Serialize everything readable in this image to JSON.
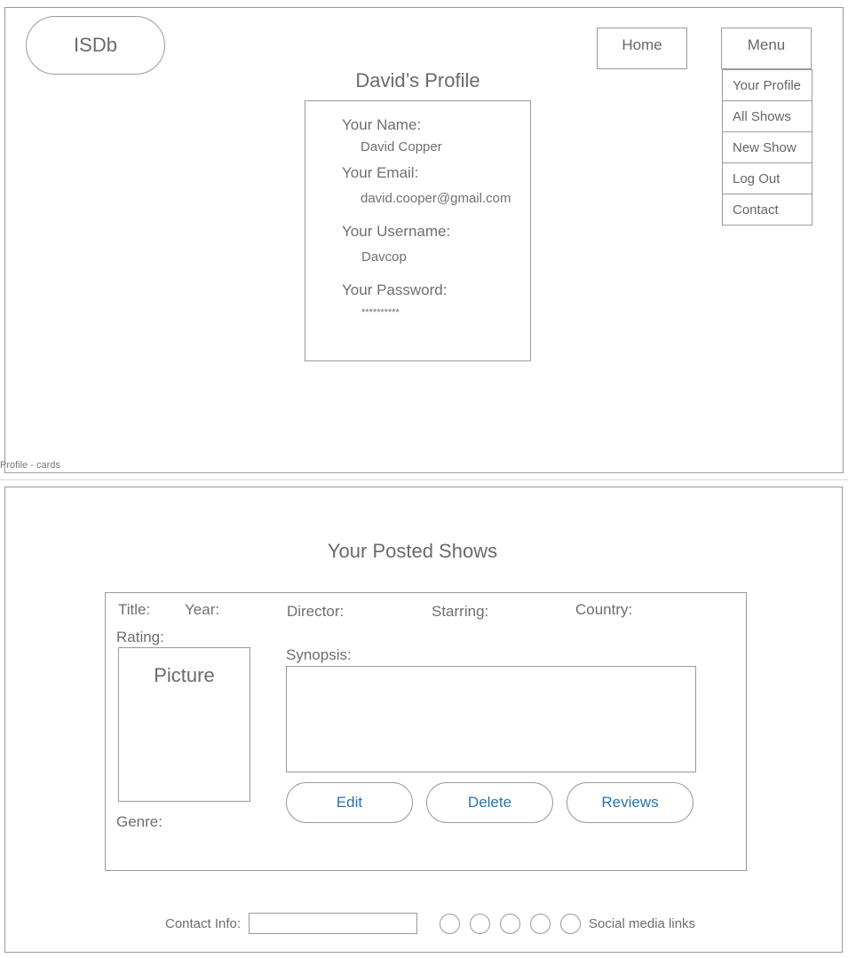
{
  "logo": {
    "text": "ISDb"
  },
  "nav": {
    "home_label": "Home",
    "menu_label": "Menu"
  },
  "menu": {
    "items": [
      {
        "label": "Your Profile"
      },
      {
        "label": "All Shows"
      },
      {
        "label": "New Show"
      },
      {
        "label": "Log Out"
      },
      {
        "label": "Contact"
      }
    ]
  },
  "profile": {
    "title": "David’s Profile",
    "name_label": "Your Name:",
    "name_value": "David Copper",
    "email_label": "Your Email:",
    "email_value": "david.cooper@gmail.com",
    "username_label": "Your Username:",
    "username_value": "Davcop",
    "password_label": "Your Password:",
    "password_value": "**********"
  },
  "frame_caption": "Profile - cards",
  "shows": {
    "title": "Your Posted Shows",
    "card": {
      "title_label": "Title:",
      "year_label": "Year:",
      "director_label": "Director:",
      "starring_label": "Starring:",
      "country_label": "Country:",
      "rating_label": "Rating:",
      "picture_label": "Picture",
      "synopsis_label": "Synopsis:",
      "genre_label": "Genre:",
      "edit_label": "Edit",
      "delete_label": "Delete",
      "reviews_label": "Reviews"
    }
  },
  "footer": {
    "contact_label": "Contact Info:",
    "contact_value": "",
    "social_label": "Social media links",
    "social_icons": [
      "social-link-1",
      "social-link-2",
      "social-link-3",
      "social-link-4",
      "social-link-5"
    ]
  }
}
